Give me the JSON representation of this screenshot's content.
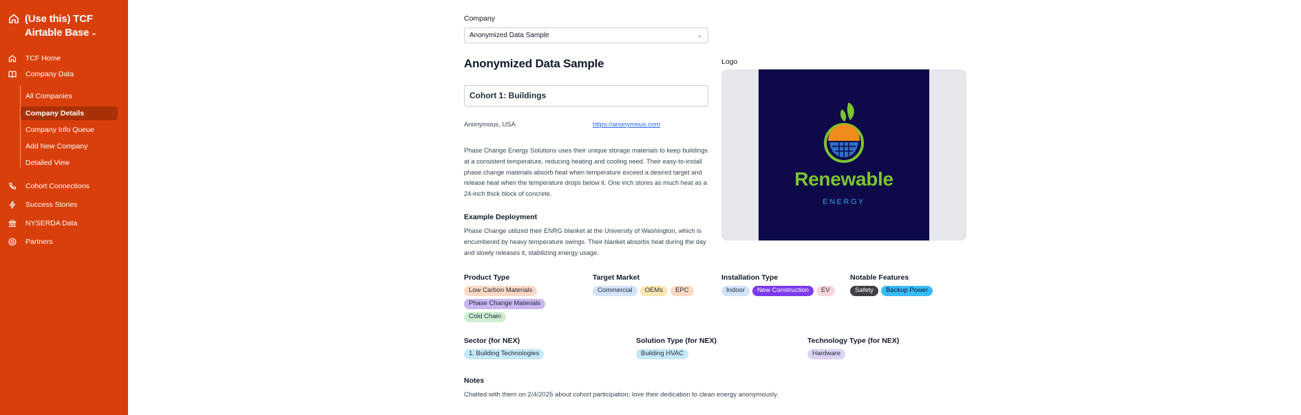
{
  "sidebar": {
    "brand_title": "(Use this) TCF Airtable Base",
    "nav": {
      "tcf_home": "TCF Home",
      "company_data": "Company Data",
      "sub_items": [
        "All Companies",
        "Company Details",
        "Company Info Queue",
        "Add New Company",
        "Detailed View"
      ],
      "cohort_connections": "Cohort Connections",
      "success_stories": "Success Stories",
      "nyserda_data": "NYSERDA Data",
      "partners": "Partners"
    }
  },
  "main": {
    "company_label": "Company",
    "company_select_value": "Anonymized Data Sample",
    "company_name": "Anonymized Data Sample",
    "cohort": "Cohort 1: Buildings",
    "location": "Anonymous, USA",
    "website": "https://anonymous.com",
    "description": "Phase Change Energy Solutions uses their unique storage materials to keep buildings at a consistent temperature, reducing heating and cooling need. Their easy-to-install phase change materials absorb heat when temperature exceed a desired target and release heat when the temperature drops below it. One inch stores as much heat as a 24-inch thick block of concrete.",
    "example_label": "Example Deployment",
    "example_text": "Phase Change utilized their ENRG blanket at the University of Washington, which is encumbered by heavy temperature swings. Their blanket absorbs heat during the day and slowly releases it, stabilizing energy usage.",
    "logo_label": "Logo",
    "logo_word": "Renewable",
    "logo_sub": "ENERGY",
    "product_type_label": "Product Type",
    "product_types": [
      {
        "text": "Low Carbon Materials",
        "color": "#fcd9c4"
      },
      {
        "text": "Phase Change Materials",
        "color": "#c9b6f2"
      },
      {
        "text": "Cold Chain",
        "color": "#cdeecf"
      }
    ],
    "target_market_label": "Target Market",
    "target_markets": [
      {
        "text": "Commercial",
        "color": "#d3e3fb"
      },
      {
        "text": "OEMs",
        "color": "#fde7b0"
      },
      {
        "text": "EPC",
        "color": "#fcd9c4"
      }
    ],
    "installation_type_label": "Installation Type",
    "installation_types": [
      {
        "text": "Indoor",
        "color": "#d3e3fb",
        "fg": "#1f2937"
      },
      {
        "text": "New Construction",
        "color": "#7c3aed",
        "fg": "#ffffff"
      },
      {
        "text": "EV",
        "color": "#fbd5dc",
        "fg": "#1f2937"
      }
    ],
    "notable_features_label": "Notable Features",
    "notable_features": [
      {
        "text": "Safety",
        "color": "#3f3f46",
        "fg": "#ffffff"
      },
      {
        "text": "Backup Power",
        "color": "#38bdf8",
        "fg": "#0f172a"
      }
    ],
    "sector_label": "Sector (for NEX)",
    "sector": {
      "text": "1. Building Technologies",
      "color": "#c6e8f7"
    },
    "solution_label": "Solution Type (for NEX)",
    "solution": {
      "text": "Building HVAC",
      "color": "#c6e8f7"
    },
    "technology_label": "Technology Type (for NEX)",
    "technology": {
      "text": "Hardware",
      "color": "#ddd3f5"
    },
    "notes_label": "Notes",
    "notes_text": "Chatted with them on 2/4/2025 about cohort participation; love their dedication to clean energy anonymously."
  }
}
